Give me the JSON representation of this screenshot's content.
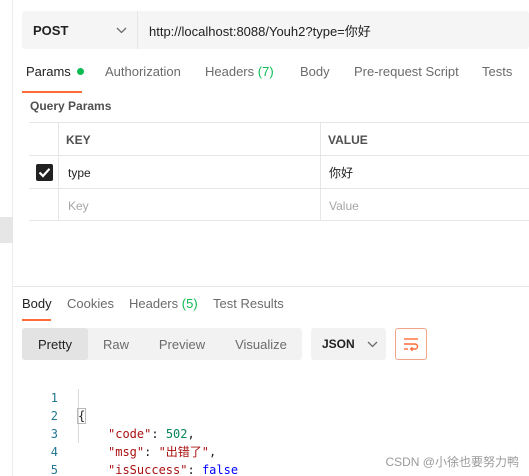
{
  "request": {
    "method": "POST",
    "url": "http://localhost:8088/Youh2?type=你好"
  },
  "request_tabs": [
    {
      "label": "Params",
      "active": true,
      "has_dot": true
    },
    {
      "label": "Authorization"
    },
    {
      "label": "Headers",
      "count": "(7)"
    },
    {
      "label": "Body"
    },
    {
      "label": "Pre-request Script"
    },
    {
      "label": "Tests"
    }
  ],
  "query_params": {
    "title": "Query Params",
    "headers": {
      "key": "KEY",
      "value": "VALUE"
    },
    "rows": [
      {
        "checked": true,
        "key": "type",
        "value": "你好"
      }
    ],
    "placeholder": {
      "key": "Key",
      "value": "Value"
    }
  },
  "response_tabs": [
    {
      "label": "Body",
      "active": true
    },
    {
      "label": "Cookies"
    },
    {
      "label": "Headers",
      "count": "(5)"
    },
    {
      "label": "Test Results"
    }
  ],
  "view_modes": [
    {
      "label": "Pretty",
      "active": true
    },
    {
      "label": "Raw"
    },
    {
      "label": "Preview"
    },
    {
      "label": "Visualize"
    }
  ],
  "format_select": {
    "value": "JSON"
  },
  "response_body": {
    "line_numbers": [
      "1",
      "2",
      "3",
      "4",
      "5"
    ],
    "open_brace": "{",
    "close_brace": "}",
    "fields": [
      {
        "key": "\"code\"",
        "value": "502",
        "type": "number"
      },
      {
        "key": "\"msg\"",
        "value": "\"出错了\"",
        "type": "string"
      },
      {
        "key": "\"isSuccess\"",
        "value": "false",
        "type": "boolean"
      }
    ]
  },
  "watermark": "CSDN @小徐也要努力鸭",
  "colors": {
    "accent": "#ff6c37",
    "green": "#0cbb52"
  },
  "icons": {
    "method_dropdown": "chevron-down-icon",
    "format_dropdown": "chevron-down-icon",
    "wrap": "wrap-lines-icon",
    "checkbox": "check-icon"
  }
}
